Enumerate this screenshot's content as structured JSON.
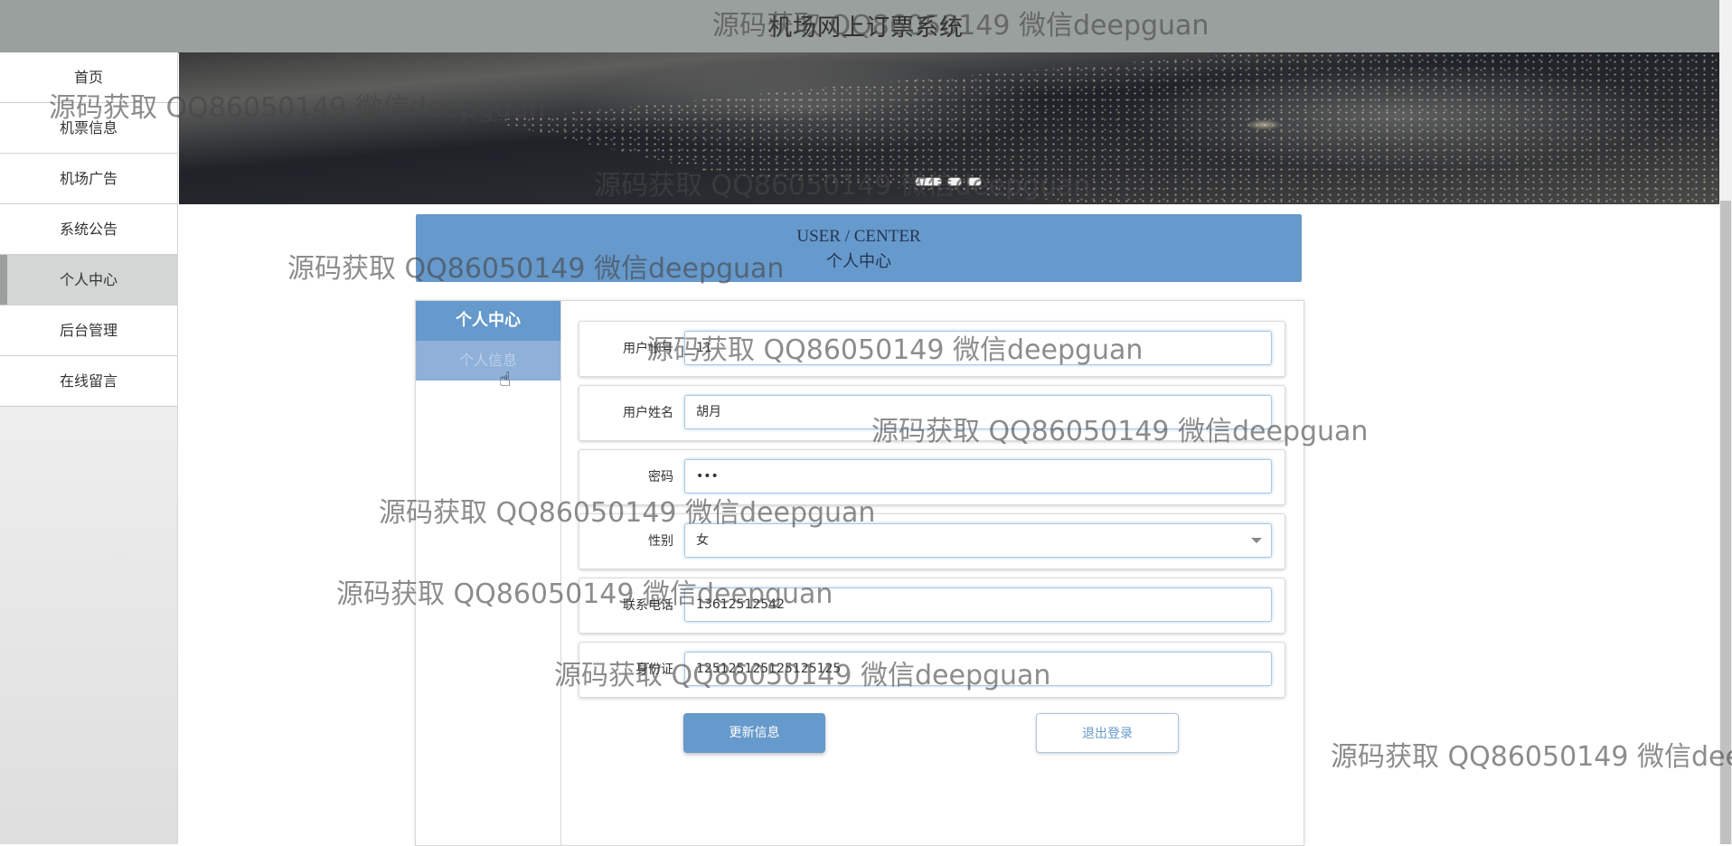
{
  "app": {
    "title": "机场网上订票系统"
  },
  "sidebar": {
    "items": [
      {
        "label": "首页"
      },
      {
        "label": "机票信息"
      },
      {
        "label": "机场广告"
      },
      {
        "label": "系统公告"
      },
      {
        "label": "个人中心",
        "active": true
      },
      {
        "label": "后台管理"
      },
      {
        "label": "在线留言"
      }
    ]
  },
  "banner": {
    "active_slide": 1,
    "slide_count": 3
  },
  "center_header": {
    "en": "USER / CENTER",
    "cn": "个人中心"
  },
  "left_menu": {
    "heading": "个人中心",
    "items": [
      {
        "label": "个人信息"
      }
    ]
  },
  "form": {
    "fields": [
      {
        "label": "用户帐号",
        "value": "11"
      },
      {
        "label": "用户姓名",
        "value": "胡月"
      },
      {
        "label": "密码",
        "value": "•••"
      },
      {
        "label": "性别",
        "value": "女"
      },
      {
        "label": "联系电话",
        "value": "13612512542"
      },
      {
        "label": "身份证",
        "value": "125125125125125125"
      }
    ],
    "update_button": "更新信息",
    "logout_button": "退出登录"
  },
  "watermark": {
    "text": "源码获取 QQ86050149 微信deepguan",
    "top_text": "源码获取 QQ86050149 微信deepguan"
  },
  "colors": {
    "accent": "#6699cc",
    "topbar": "#9aa09e"
  }
}
